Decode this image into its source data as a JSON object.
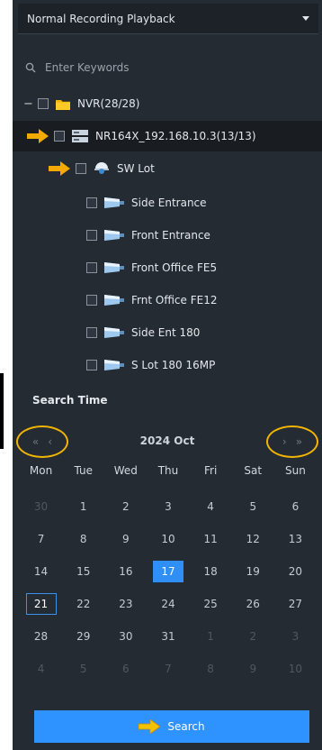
{
  "mode_select": {
    "value": "Normal Recording Playback"
  },
  "search": {
    "placeholder": "Enter Keywords"
  },
  "tree": {
    "nvr_root": {
      "label": "NVR(28/28)"
    },
    "device": {
      "label": "NR164X_192.168.10.3(13/13)"
    },
    "cameras": [
      {
        "label": "SW Lot"
      },
      {
        "label": "Side Entrance"
      },
      {
        "label": "Front Entrance"
      },
      {
        "label": "Front Office FE5"
      },
      {
        "label": "Frnt Office FE12"
      },
      {
        "label": "Side Ent 180"
      },
      {
        "label": "S Lot 180 16MP"
      }
    ]
  },
  "calendar": {
    "title": "Search Time",
    "month_label": "2024 Oct",
    "weekdays": [
      "Mon",
      "Tue",
      "Wed",
      "Thu",
      "Fri",
      "Sat",
      "Sun"
    ],
    "days": [
      {
        "d": "30",
        "m": true
      },
      {
        "d": "1"
      },
      {
        "d": "2"
      },
      {
        "d": "3"
      },
      {
        "d": "4"
      },
      {
        "d": "5"
      },
      {
        "d": "6"
      },
      {
        "d": "7"
      },
      {
        "d": "8"
      },
      {
        "d": "9"
      },
      {
        "d": "10"
      },
      {
        "d": "11"
      },
      {
        "d": "12"
      },
      {
        "d": "13"
      },
      {
        "d": "14"
      },
      {
        "d": "15"
      },
      {
        "d": "16"
      },
      {
        "d": "17",
        "today": true
      },
      {
        "d": "18"
      },
      {
        "d": "19"
      },
      {
        "d": "20"
      },
      {
        "d": "21",
        "sel": true
      },
      {
        "d": "22"
      },
      {
        "d": "23"
      },
      {
        "d": "24"
      },
      {
        "d": "25"
      },
      {
        "d": "26"
      },
      {
        "d": "27"
      },
      {
        "d": "28"
      },
      {
        "d": "29"
      },
      {
        "d": "30"
      },
      {
        "d": "31"
      },
      {
        "d": "1",
        "m": true
      },
      {
        "d": "2",
        "m": true
      },
      {
        "d": "3",
        "m": true
      },
      {
        "d": "4",
        "m": true
      },
      {
        "d": "5",
        "m": true
      },
      {
        "d": "6",
        "m": true
      },
      {
        "d": "7",
        "m": true
      },
      {
        "d": "8",
        "m": true
      },
      {
        "d": "9",
        "m": true
      },
      {
        "d": "10",
        "m": true
      }
    ],
    "prev_year": "«",
    "prev_month": "‹",
    "next_month": "›",
    "next_year": "»"
  },
  "search_button": {
    "label": "Search"
  },
  "colors": {
    "accent": "#2f93ff",
    "annotation": "#f2b600",
    "panel": "#252b33"
  },
  "icons": {
    "folder": "folder-icon",
    "nvr": "nvr-device-icon",
    "dome": "dome-camera-icon",
    "bullet": "bullet-camera-icon",
    "arrow": "annotation-arrow-icon"
  }
}
